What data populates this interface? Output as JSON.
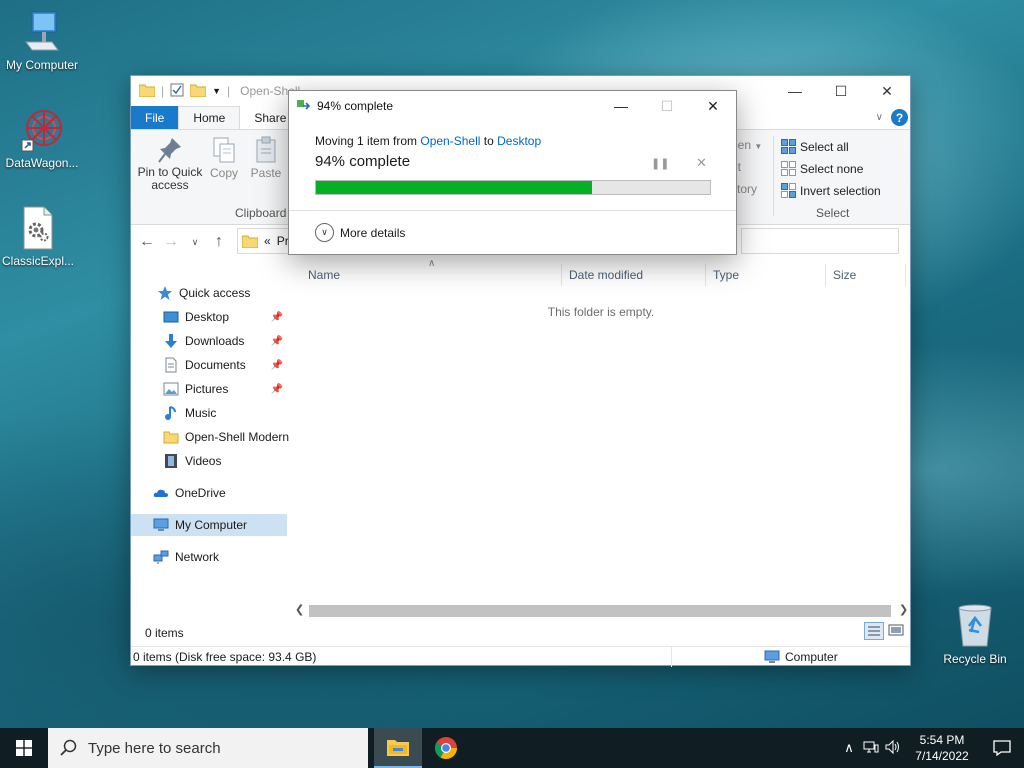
{
  "desktop": {
    "icons": [
      {
        "label": "My Computer",
        "icon": "computer-icon"
      },
      {
        "label": "DataWagon...",
        "icon": "datawagon-icon"
      },
      {
        "label": "ClassicExpl...",
        "icon": "settings-file-icon"
      },
      {
        "label": "Recycle Bin",
        "icon": "recycle-bin-icon"
      }
    ]
  },
  "explorer": {
    "title": "Open-Shell",
    "tabs": {
      "file": "File",
      "home": "Home",
      "share": "Share"
    },
    "ribbon": {
      "pin": "Pin to Quick access",
      "copy": "Copy",
      "paste": "Paste",
      "clipboard_group": "Clipboard",
      "open_partial": "pen",
      "edit_partial": "it",
      "history_partial": "story",
      "select_all": "Select all",
      "select_none": "Select none",
      "invert_selection": "Invert selection",
      "select_group": "Select"
    },
    "address": {
      "chevron": "«",
      "path_partial": "Pr"
    },
    "nav": {
      "quick_access": "Quick access",
      "desktop": "Desktop",
      "downloads": "Downloads",
      "documents": "Documents",
      "pictures": "Pictures",
      "music": "Music",
      "open_shell": "Open-Shell Modern",
      "videos": "Videos",
      "onedrive": "OneDrive",
      "my_computer": "My Computer",
      "network": "Network"
    },
    "columns": {
      "name": "Name",
      "date": "Date modified",
      "type": "Type",
      "size": "Size"
    },
    "empty_message": "This folder is empty.",
    "item_count": "0 items",
    "status_detail": "0 items (Disk free space: 93.4 GB)",
    "status_location": "Computer"
  },
  "dialog": {
    "title": "94% complete",
    "moving_prefix": "Moving 1 item from",
    "source": "Open-Shell",
    "to_word": "to",
    "destination": "Desktop",
    "percent_text": "94% complete",
    "progress_fraction": 0.7,
    "more_details": "More details"
  },
  "taskbar": {
    "search_placeholder": "Type here to search",
    "time": "5:54 PM",
    "date": "7/14/2022"
  },
  "colors": {
    "accent": "#1979ca",
    "progress": "#06b025",
    "link": "#0066cc"
  }
}
